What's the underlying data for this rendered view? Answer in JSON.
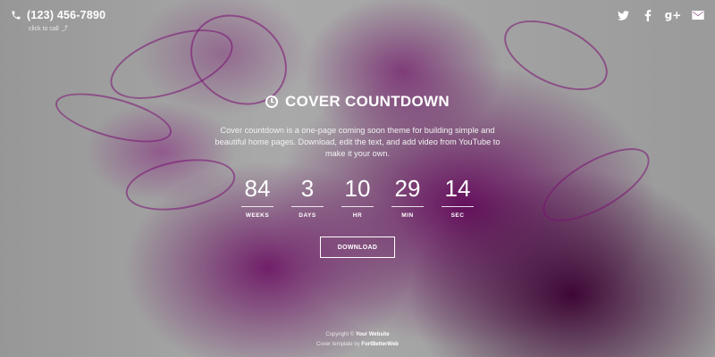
{
  "header": {
    "phone": "(123) 456-7890",
    "click_to_call": "click to call",
    "social_icons": [
      "twitter-icon",
      "facebook-icon",
      "google-plus-icon",
      "email-icon"
    ]
  },
  "main": {
    "title": "COVER COUNTDOWN",
    "description": "Cover countdown is a one-page coming soon theme for building simple and beautiful home pages. Download, edit the text, and add video from YouTube to make it your own.",
    "countdown": [
      {
        "value": "84",
        "label": "WEEKS"
      },
      {
        "value": "3",
        "label": "DAYS"
      },
      {
        "value": "10",
        "label": "HR"
      },
      {
        "value": "29",
        "label": "MIN"
      },
      {
        "value": "14",
        "label": "SEC"
      }
    ],
    "download_label": "DOWNLOAD"
  },
  "footer": {
    "copyright_prefix": "Copyright ©",
    "website": "Your Website",
    "template_prefix": "Cover template by",
    "author": "FortBetterWeb"
  },
  "colors": {
    "accent": "#8e1d86",
    "text": "#ffffff"
  }
}
